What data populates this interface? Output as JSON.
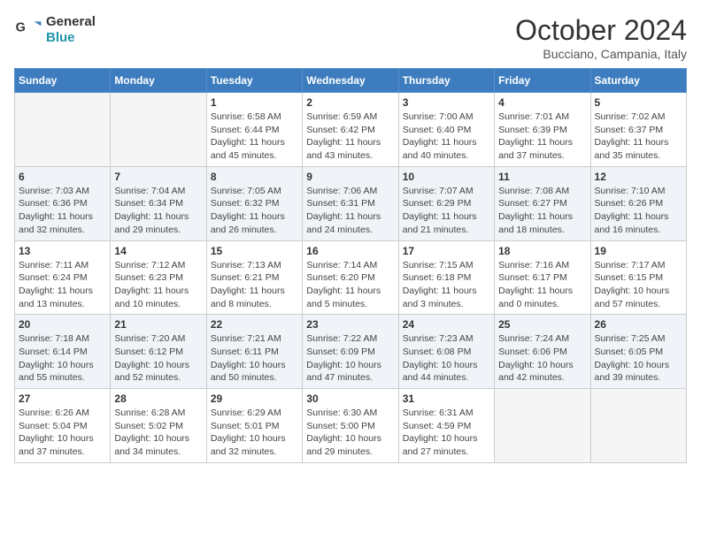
{
  "logo": {
    "line1": "General",
    "line2": "Blue"
  },
  "title": "October 2024",
  "subtitle": "Bucciano, Campania, Italy",
  "days_of_week": [
    "Sunday",
    "Monday",
    "Tuesday",
    "Wednesday",
    "Thursday",
    "Friday",
    "Saturday"
  ],
  "weeks": [
    [
      {
        "day": "",
        "info": ""
      },
      {
        "day": "",
        "info": ""
      },
      {
        "day": "1",
        "info": "Sunrise: 6:58 AM\nSunset: 6:44 PM\nDaylight: 11 hours and 45 minutes."
      },
      {
        "day": "2",
        "info": "Sunrise: 6:59 AM\nSunset: 6:42 PM\nDaylight: 11 hours and 43 minutes."
      },
      {
        "day": "3",
        "info": "Sunrise: 7:00 AM\nSunset: 6:40 PM\nDaylight: 11 hours and 40 minutes."
      },
      {
        "day": "4",
        "info": "Sunrise: 7:01 AM\nSunset: 6:39 PM\nDaylight: 11 hours and 37 minutes."
      },
      {
        "day": "5",
        "info": "Sunrise: 7:02 AM\nSunset: 6:37 PM\nDaylight: 11 hours and 35 minutes."
      }
    ],
    [
      {
        "day": "6",
        "info": "Sunrise: 7:03 AM\nSunset: 6:36 PM\nDaylight: 11 hours and 32 minutes."
      },
      {
        "day": "7",
        "info": "Sunrise: 7:04 AM\nSunset: 6:34 PM\nDaylight: 11 hours and 29 minutes."
      },
      {
        "day": "8",
        "info": "Sunrise: 7:05 AM\nSunset: 6:32 PM\nDaylight: 11 hours and 26 minutes."
      },
      {
        "day": "9",
        "info": "Sunrise: 7:06 AM\nSunset: 6:31 PM\nDaylight: 11 hours and 24 minutes."
      },
      {
        "day": "10",
        "info": "Sunrise: 7:07 AM\nSunset: 6:29 PM\nDaylight: 11 hours and 21 minutes."
      },
      {
        "day": "11",
        "info": "Sunrise: 7:08 AM\nSunset: 6:27 PM\nDaylight: 11 hours and 18 minutes."
      },
      {
        "day": "12",
        "info": "Sunrise: 7:10 AM\nSunset: 6:26 PM\nDaylight: 11 hours and 16 minutes."
      }
    ],
    [
      {
        "day": "13",
        "info": "Sunrise: 7:11 AM\nSunset: 6:24 PM\nDaylight: 11 hours and 13 minutes."
      },
      {
        "day": "14",
        "info": "Sunrise: 7:12 AM\nSunset: 6:23 PM\nDaylight: 11 hours and 10 minutes."
      },
      {
        "day": "15",
        "info": "Sunrise: 7:13 AM\nSunset: 6:21 PM\nDaylight: 11 hours and 8 minutes."
      },
      {
        "day": "16",
        "info": "Sunrise: 7:14 AM\nSunset: 6:20 PM\nDaylight: 11 hours and 5 minutes."
      },
      {
        "day": "17",
        "info": "Sunrise: 7:15 AM\nSunset: 6:18 PM\nDaylight: 11 hours and 3 minutes."
      },
      {
        "day": "18",
        "info": "Sunrise: 7:16 AM\nSunset: 6:17 PM\nDaylight: 11 hours and 0 minutes."
      },
      {
        "day": "19",
        "info": "Sunrise: 7:17 AM\nSunset: 6:15 PM\nDaylight: 10 hours and 57 minutes."
      }
    ],
    [
      {
        "day": "20",
        "info": "Sunrise: 7:18 AM\nSunset: 6:14 PM\nDaylight: 10 hours and 55 minutes."
      },
      {
        "day": "21",
        "info": "Sunrise: 7:20 AM\nSunset: 6:12 PM\nDaylight: 10 hours and 52 minutes."
      },
      {
        "day": "22",
        "info": "Sunrise: 7:21 AM\nSunset: 6:11 PM\nDaylight: 10 hours and 50 minutes."
      },
      {
        "day": "23",
        "info": "Sunrise: 7:22 AM\nSunset: 6:09 PM\nDaylight: 10 hours and 47 minutes."
      },
      {
        "day": "24",
        "info": "Sunrise: 7:23 AM\nSunset: 6:08 PM\nDaylight: 10 hours and 44 minutes."
      },
      {
        "day": "25",
        "info": "Sunrise: 7:24 AM\nSunset: 6:06 PM\nDaylight: 10 hours and 42 minutes."
      },
      {
        "day": "26",
        "info": "Sunrise: 7:25 AM\nSunset: 6:05 PM\nDaylight: 10 hours and 39 minutes."
      }
    ],
    [
      {
        "day": "27",
        "info": "Sunrise: 6:26 AM\nSunset: 5:04 PM\nDaylight: 10 hours and 37 minutes."
      },
      {
        "day": "28",
        "info": "Sunrise: 6:28 AM\nSunset: 5:02 PM\nDaylight: 10 hours and 34 minutes."
      },
      {
        "day": "29",
        "info": "Sunrise: 6:29 AM\nSunset: 5:01 PM\nDaylight: 10 hours and 32 minutes."
      },
      {
        "day": "30",
        "info": "Sunrise: 6:30 AM\nSunset: 5:00 PM\nDaylight: 10 hours and 29 minutes."
      },
      {
        "day": "31",
        "info": "Sunrise: 6:31 AM\nSunset: 4:59 PM\nDaylight: 10 hours and 27 minutes."
      },
      {
        "day": "",
        "info": ""
      },
      {
        "day": "",
        "info": ""
      }
    ]
  ]
}
